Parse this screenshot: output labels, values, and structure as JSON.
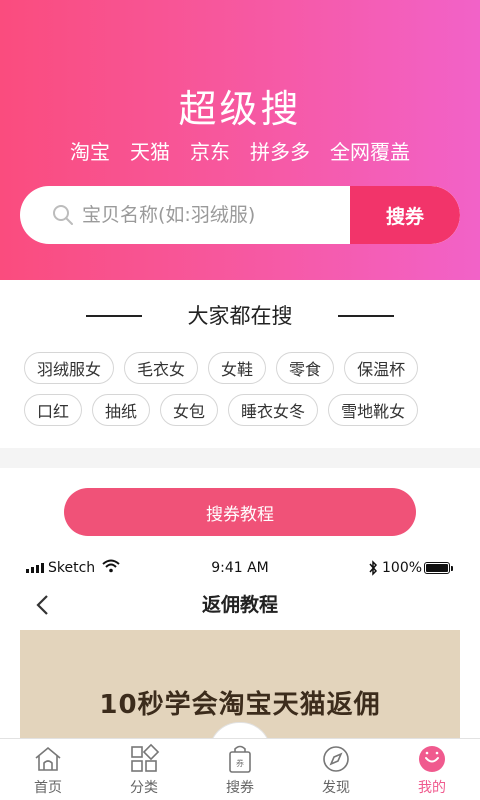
{
  "hero": {
    "title": "超级搜",
    "platforms": [
      "淘宝",
      "天猫",
      "京东",
      "拼多多",
      "全网覆盖"
    ]
  },
  "search": {
    "placeholder": "宝贝名称(如:羽绒服)",
    "button_label": "搜券"
  },
  "hot": {
    "title": "大家都在搜",
    "tags_row1": [
      "羽绒服女",
      "毛衣女",
      "女鞋",
      "零食",
      "保温杯"
    ],
    "tags_row2": [
      "口红",
      "抽纸",
      "女包",
      "睡衣女冬",
      "雪地靴女"
    ]
  },
  "tutorial": {
    "button_label": "搜券教程"
  },
  "embedded": {
    "status": {
      "carrier": "Sketch",
      "time": "9:41 AM",
      "battery": "100%"
    },
    "nav_title": "返佣教程",
    "banner_text": "10秒学会淘宝天猫返佣"
  },
  "tabbar": {
    "items": [
      {
        "label": "首页",
        "icon": "home-icon"
      },
      {
        "label": "分类",
        "icon": "category-icon"
      },
      {
        "label": "搜券",
        "icon": "coupon-bag-icon"
      },
      {
        "label": "发现",
        "icon": "compass-icon"
      },
      {
        "label": "我的",
        "icon": "profile-icon"
      }
    ],
    "active_index": 4
  },
  "colors": {
    "brand_pink": "#f2346a",
    "gradient_start": "#fa4c7e",
    "gradient_end": "#f262c8",
    "active_tab": "#f05a8e"
  }
}
